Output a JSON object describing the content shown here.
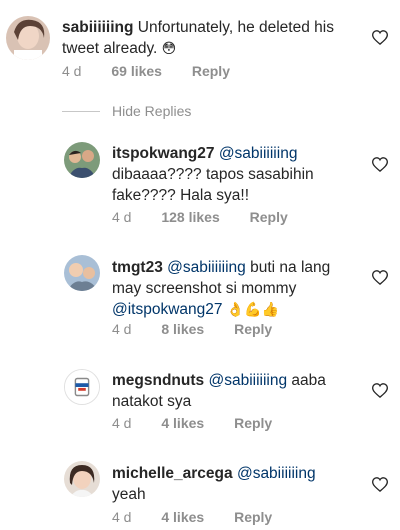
{
  "parent": {
    "username": "sabiiiiiing",
    "text_line1": "Unfortunately, he deleted his",
    "text_line2": "tweet already.",
    "emoji": "😳",
    "time": "4 d",
    "likes": "69 likes",
    "reply": "Reply"
  },
  "hide_replies": "Hide Replies",
  "replies": [
    {
      "username": "itspokwang27",
      "mention": "@sabiiiiiing",
      "line2": "dibaaaa???? tapos sasabihin",
      "line3": "fake???? Hala sya!!",
      "time": "4 d",
      "likes": "128 likes",
      "reply": "Reply"
    },
    {
      "username": "tmgt23",
      "mention": "@sabiiiiiing",
      "text_after": "buti na lang",
      "line2": "may screenshot si mommy",
      "mention2": "@itspokwang27",
      "emojis": "👌💪👍",
      "time": "4 d",
      "likes": "8 likes",
      "reply": "Reply"
    },
    {
      "username": "megsndnuts",
      "mention": "@sabiiiiiing",
      "text_after": "aaba",
      "line2": "natakot sya",
      "time": "4 d",
      "likes": "4 likes",
      "reply": "Reply"
    },
    {
      "username": "michelle_arcega",
      "mention": "@sabiiiiiing",
      "line2": "yeah",
      "time": "4 d",
      "likes": "4 likes",
      "reply": "Reply"
    }
  ],
  "colors": {
    "text": "#262626",
    "mention": "#003569",
    "meta": "#8e8e8e"
  },
  "icons": [
    "heart-outline-icon"
  ]
}
